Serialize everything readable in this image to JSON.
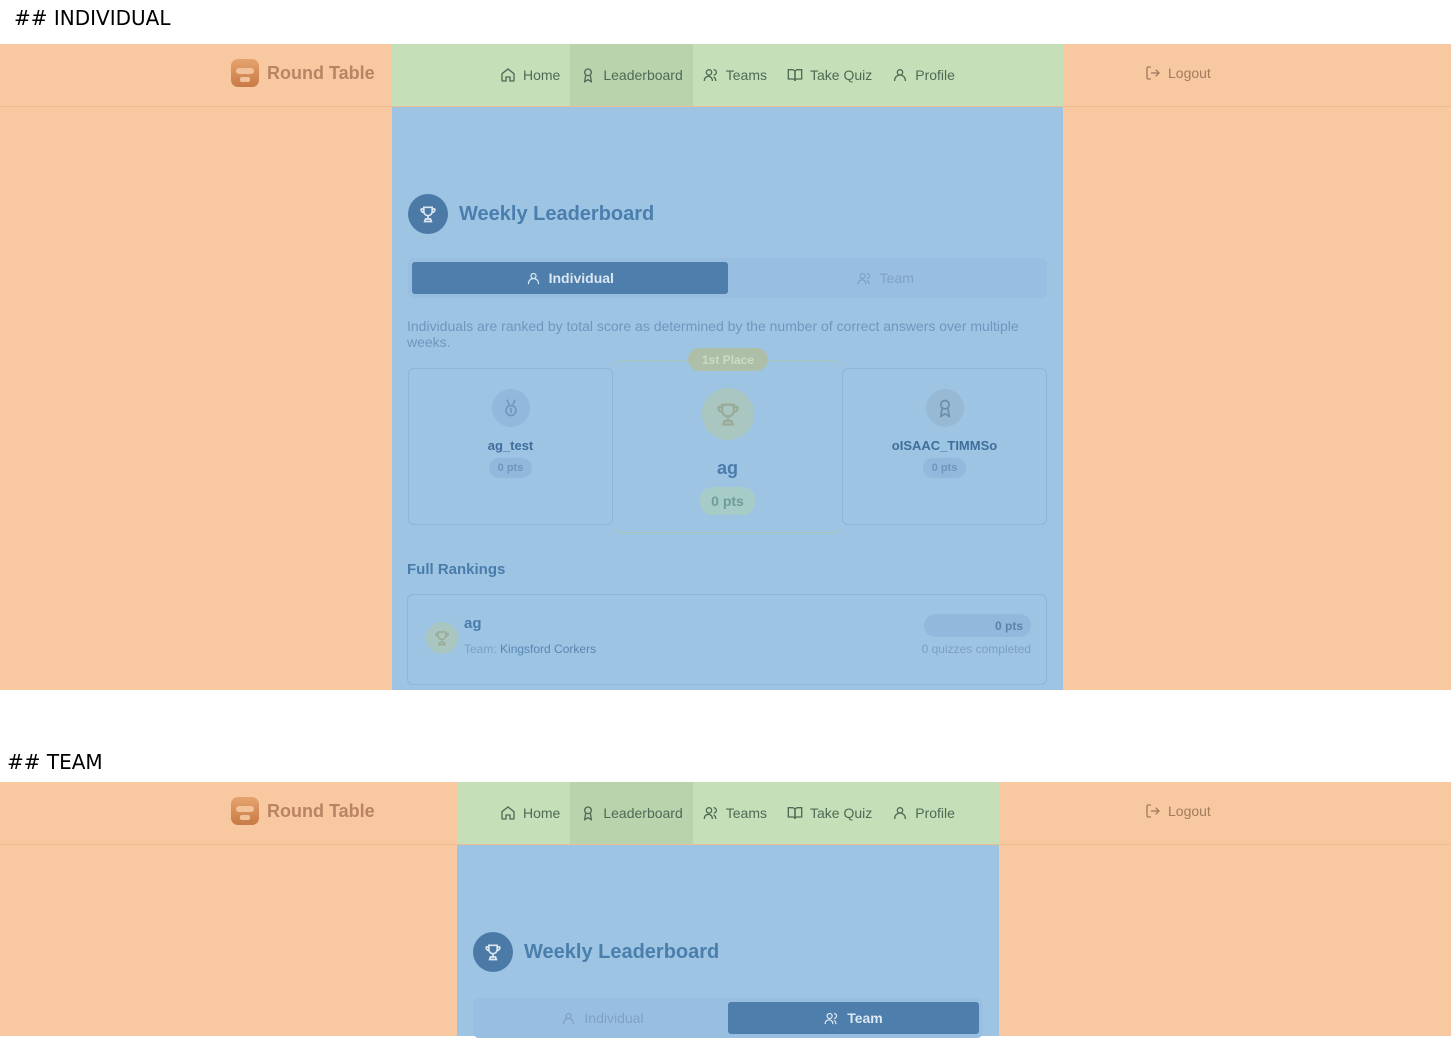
{
  "sections": {
    "individual_heading": "## INDIVIDUAL",
    "team_heading": "## TEAM"
  },
  "brand": {
    "name": "Round Table"
  },
  "nav": {
    "items": [
      {
        "label": "Home",
        "icon": "home-icon"
      },
      {
        "label": "Leaderboard",
        "icon": "award-icon",
        "active": true
      },
      {
        "label": "Teams",
        "icon": "users-icon"
      },
      {
        "label": "Take Quiz",
        "icon": "book-icon"
      },
      {
        "label": "Profile",
        "icon": "user-icon"
      }
    ],
    "logout": "Logout"
  },
  "leaderboard": {
    "title": "Weekly Leaderboard",
    "tabs": {
      "individual": "Individual",
      "team": "Team"
    },
    "description": "Individuals are ranked by total score as determined by the number of correct answers over multiple weeks.",
    "first_place_badge": "1st Place",
    "podium": {
      "second": {
        "name": "ag_test",
        "points": "0 pts"
      },
      "first": {
        "name": "ag",
        "points": "0 pts"
      },
      "third": {
        "name": "oISAAC_TIMMSo",
        "points": "0 pts"
      }
    },
    "full_rankings_heading": "Full Rankings",
    "rankings": [
      {
        "name": "ag",
        "team_prefix": "Team:",
        "team": "Kingsford Corkers",
        "points": "0 pts",
        "quizzes": "0 quizzes completed"
      }
    ]
  },
  "colors": {
    "margin_overlay": "#f8c9a0",
    "nav_overlay": "#c5dfb8",
    "content_overlay": "#9ec4e4",
    "accent": "#4e7eab"
  }
}
